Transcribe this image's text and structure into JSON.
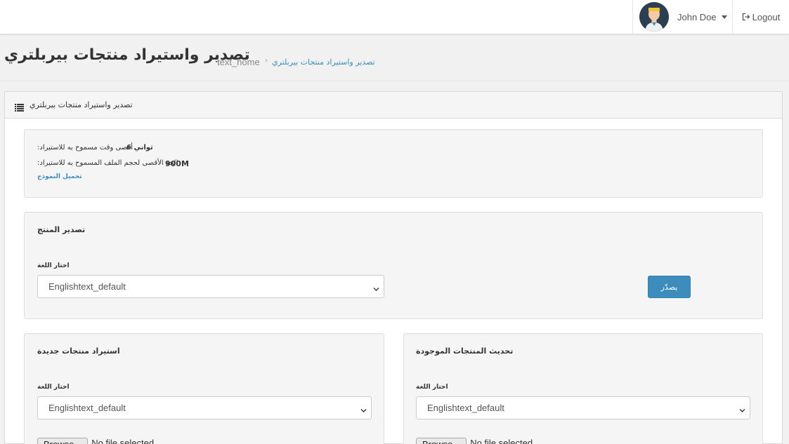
{
  "header": {
    "user_name": "John Doe",
    "logout_label": "Logout"
  },
  "page": {
    "title": "تصدير واستيراد منتجات بيربلتري",
    "breadcrumb_home": "text_home",
    "breadcrumb_current": "تصدير واستيراد منتجات بيربلتري"
  },
  "panel": {
    "title": "تصدير واستيراد منتجات بيربلتري",
    "info": {
      "max_time_label": ":أقصى وقت مسموح به للاستيراد",
      "max_time_value": "6 ثواني",
      "max_size_label": ":الحد الأقصى لحجم الملف المسموح به للاستيراد",
      "max_size_value": "900M",
      "download_template_link": "تحميل النموذج"
    },
    "export": {
      "title": "تصدير المنتج",
      "language_label": "اختار اللغة",
      "language_selected": "Englishtext_default",
      "export_button": "يصدّر"
    },
    "import_new": {
      "title": "استيراد منتجات جديدة",
      "language_label": "اختار اللغة",
      "language_selected": "Englishtext_default",
      "browse_button": "Browse...",
      "file_status": "No file selected."
    },
    "update_existing": {
      "title": "تحديث المنتجات الموجودة",
      "language_label": "اختار اللغة",
      "language_selected": "Englishtext_default",
      "browse_button": "Browse...",
      "file_status": "No file selected."
    }
  },
  "colors": {
    "accent": "#3c8dbc",
    "avatar_bg": "#2c3e50",
    "avatar_hair": "#f4c430"
  }
}
